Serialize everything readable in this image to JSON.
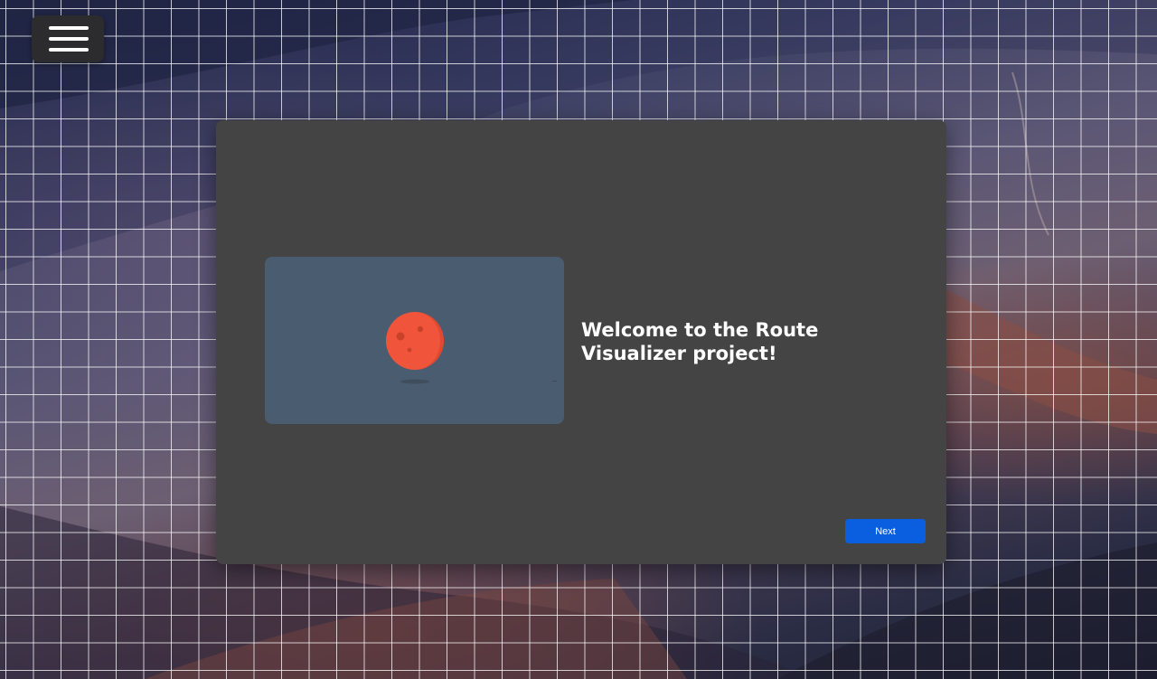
{
  "menu": {
    "icon": "hamburger-menu-icon"
  },
  "welcome": {
    "title": "Welcome to the Route Visualizer project!",
    "illustration_icon": "planet-icon"
  },
  "footer": {
    "next_label": "Next"
  },
  "colors": {
    "modal_background": "#444444",
    "illustration_background": "#4a5c70",
    "planet": "#f0553b",
    "next_button": "#0a5fe0"
  }
}
